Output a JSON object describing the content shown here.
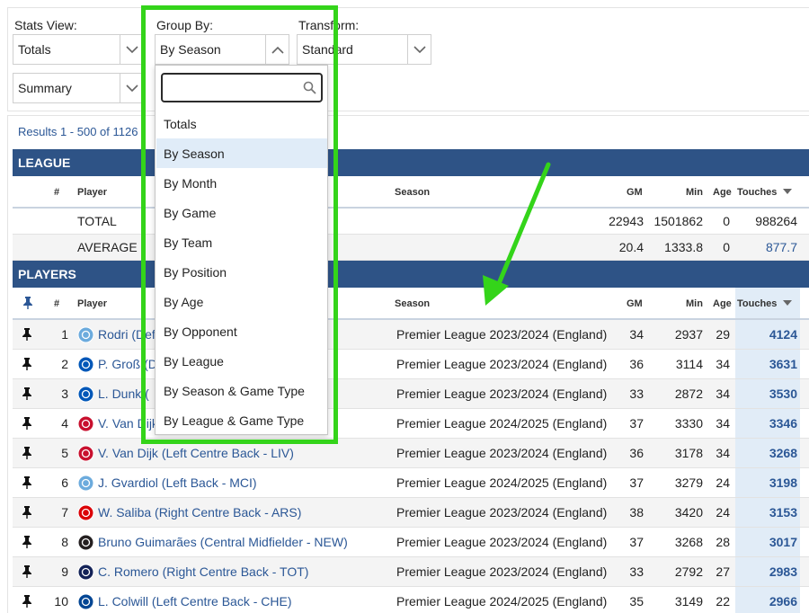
{
  "filters": {
    "stats_view": {
      "label": "Stats View:",
      "value": "Totals"
    },
    "group_by": {
      "label": "Group By:",
      "value": "By Season"
    },
    "transform": {
      "label": "Transform:",
      "value": "Standard"
    },
    "summary": {
      "value": "Summary"
    }
  },
  "dropdown": {
    "search_value": "",
    "options": [
      "Totals",
      "By Season",
      "By Month",
      "By Game",
      "By Team",
      "By Position",
      "By Age",
      "By Opponent",
      "By League",
      "By Season & Game Type",
      "By League & Game Type"
    ],
    "selected": "By Season"
  },
  "results_text": "Results 1 - 500 of 1126",
  "league": {
    "title": "LEAGUE",
    "headers": {
      "num": "#",
      "player": "Player",
      "season": "Season",
      "gm": "GM",
      "min": "Min",
      "age": "Age",
      "touches": "Touches"
    },
    "rows": [
      {
        "label": "TOTAL",
        "gm": "22943",
        "min": "1501862",
        "age": "0",
        "touches": "988264"
      },
      {
        "label": "AVERAGE",
        "gm": "20.4",
        "min": "1333.8",
        "age": "0",
        "touches": "877.7"
      }
    ]
  },
  "players": {
    "title": "PLAYERS",
    "headers": {
      "num": "#",
      "player": "Player",
      "season": "Season",
      "gm": "GM",
      "min": "Min",
      "age": "Age",
      "touches": "Touches"
    },
    "rows": [
      {
        "num": "1",
        "player": "Rodri (Defe",
        "club": "MCI",
        "season": "Premier League 2023/2024 (England)",
        "gm": "34",
        "min": "2937",
        "age": "29",
        "touches": "4124"
      },
      {
        "num": "2",
        "player": "P. Groß (De",
        "club": "BHA",
        "season": "Premier League 2023/2024 (England)",
        "gm": "36",
        "min": "3114",
        "age": "34",
        "touches": "3631"
      },
      {
        "num": "3",
        "player": "L. Dunk (",
        "club": "BHA",
        "season": "Premier League 2023/2024 (England)",
        "gm": "33",
        "min": "2872",
        "age": "34",
        "touches": "3530"
      },
      {
        "num": "4",
        "player": "V. Van Dijk",
        "club": "LIV",
        "season": "Premier League 2024/2025 (England)",
        "gm": "37",
        "min": "3330",
        "age": "34",
        "touches": "3346"
      },
      {
        "num": "5",
        "player": "V. Van Dijk (Left Centre Back - LIV)",
        "club": "LIV",
        "season": "Premier League 2023/2024 (England)",
        "gm": "36",
        "min": "3178",
        "age": "34",
        "touches": "3268"
      },
      {
        "num": "6",
        "player": "J. Gvardiol (Left Back - MCI)",
        "club": "MCI",
        "season": "Premier League 2024/2025 (England)",
        "gm": "37",
        "min": "3279",
        "age": "24",
        "touches": "3198"
      },
      {
        "num": "7",
        "player": "W. Saliba (Right Centre Back - ARS)",
        "club": "ARS",
        "season": "Premier League 2023/2024 (England)",
        "gm": "38",
        "min": "3420",
        "age": "24",
        "touches": "3153"
      },
      {
        "num": "8",
        "player": "Bruno Guimarães (Central Midfielder - NEW)",
        "club": "NEW",
        "season": "Premier League 2023/2024 (England)",
        "gm": "37",
        "min": "3268",
        "age": "28",
        "touches": "3017"
      },
      {
        "num": "9",
        "player": "C. Romero (Right Centre Back - TOT)",
        "club": "TOT",
        "season": "Premier League 2023/2024 (England)",
        "gm": "33",
        "min": "2792",
        "age": "27",
        "touches": "2983"
      },
      {
        "num": "10",
        "player": "L. Colwill (Left Centre Back - CHE)",
        "club": "CHE",
        "season": "Premier League 2024/2025 (England)",
        "gm": "35",
        "min": "3149",
        "age": "22",
        "touches": "2966"
      }
    ]
  },
  "colors": {
    "header_bar": "#2e5386",
    "link": "#2b5796",
    "highlight": "#34d41a",
    "sort_col": "#e1ecf7",
    "club_MCI": "#6cabdd",
    "club_BHA": "#0057b8",
    "club_LIV": "#c8102e",
    "club_ARS": "#db0007",
    "club_NEW": "#241f20",
    "club_TOT": "#132257",
    "club_CHE": "#034694"
  }
}
